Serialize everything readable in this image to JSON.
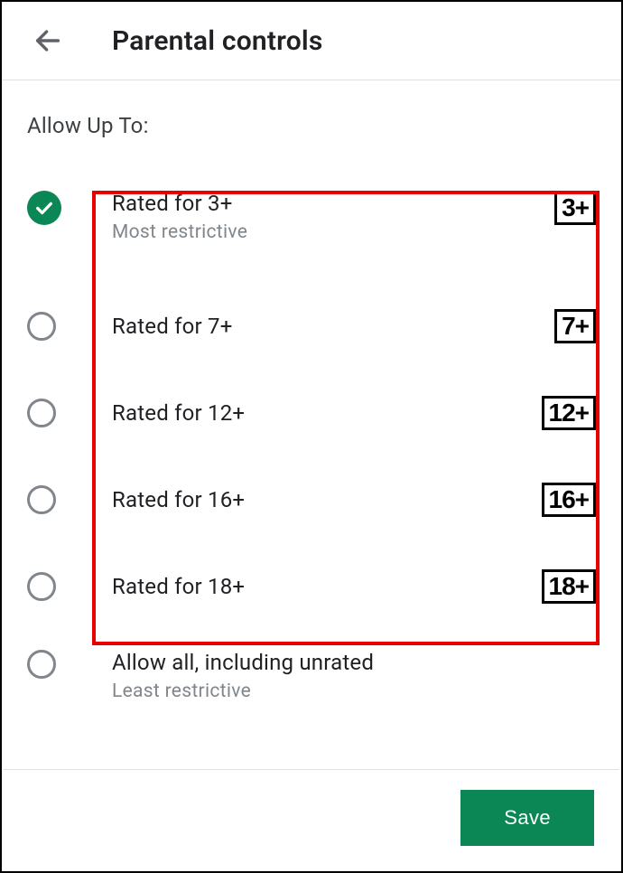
{
  "header": {
    "title": "Parental controls"
  },
  "section_label": "Allow Up To:",
  "options": [
    {
      "label": "Rated for 3+",
      "sub": "Most restrictive",
      "badge": "3+",
      "selected": true
    },
    {
      "label": "Rated for 7+",
      "sub": "",
      "badge": "7+",
      "selected": false
    },
    {
      "label": "Rated for 12+",
      "sub": "",
      "badge": "12+",
      "selected": false
    },
    {
      "label": "Rated for 16+",
      "sub": "",
      "badge": "16+",
      "selected": false
    },
    {
      "label": "Rated for 18+",
      "sub": "",
      "badge": "18+",
      "selected": false
    },
    {
      "label": "Allow all, including unrated",
      "sub": "Least restrictive",
      "badge": "",
      "selected": false
    }
  ],
  "footer": {
    "save_label": "Save"
  }
}
